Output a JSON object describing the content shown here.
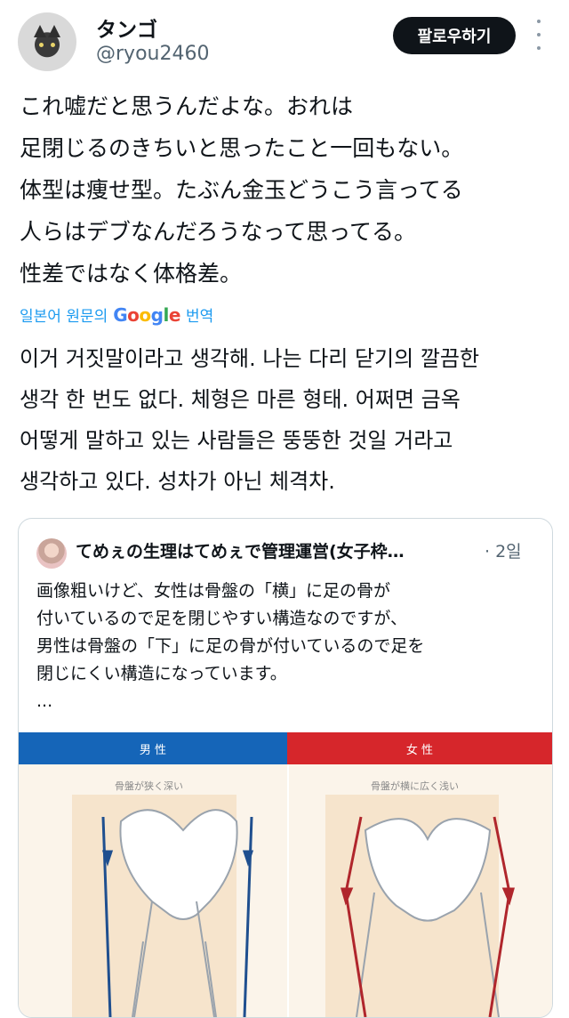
{
  "user": {
    "display_name": "タンゴ",
    "handle": "@ryou2460",
    "follow_label": "팔로우하기",
    "avatar_icon": "cat-avatar"
  },
  "tweet": {
    "lines": [
      "これ嘘だと思うんだよな。おれは",
      "足閉じるのきちいと思ったこと一回もない。",
      "体型は痩せ型。たぶん金玉どうこう言ってる",
      "人らはデブなんだろうなって思ってる。",
      "性差ではなく体格差。"
    ],
    "translate": {
      "prefix": "일본어 원문의",
      "brand": "Google",
      "suffix": "번역"
    },
    "translated_lines": [
      "이거 거짓말이라고 생각해. 나는 다리 닫기의 깔끔한",
      "생각 한 번도 없다. 체형은 마른 형태. 어쩌면 금옥",
      "어떻게 말하고 있는 사람들은 뚱뚱한 것일 거라고",
      "생각하고 있다. 성차가 아닌 체격차."
    ]
  },
  "quote": {
    "name": "てめぇの生理はてめぇで管理運営(女子枠…",
    "time": "· 2일",
    "lines": [
      "画像粗いけど、女性は骨盤の「横」に足の骨が",
      "付いているので足を閉じやすい構造なのですが、",
      "男性は骨盤の「下」に足の骨が付いているので足を",
      "閉じにくい構造になっています。",
      "..."
    ],
    "image": {
      "male_label": "男 性",
      "female_label": "女 性",
      "male_caption": "骨盤が狭く深い",
      "female_caption": "骨盤が横に広く浅い"
    }
  },
  "colors": {
    "follow_bg": "#0f1419",
    "link": "#1d9bf0",
    "male_band": "#1565b8",
    "female_band": "#d6262b"
  }
}
